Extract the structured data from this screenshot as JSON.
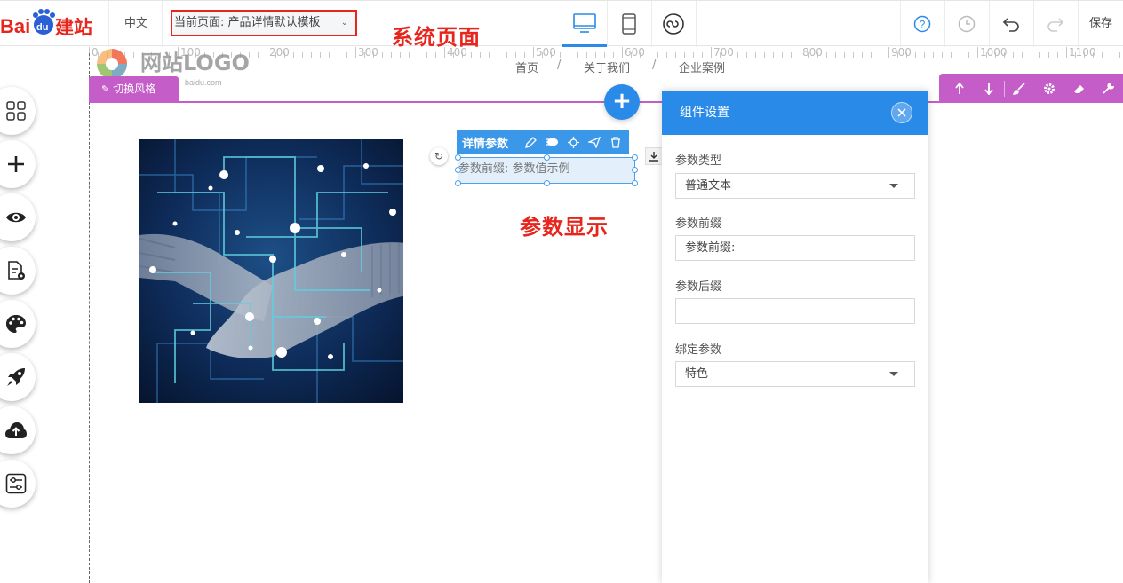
{
  "topbar": {
    "logo_text": "Bai建站",
    "language": "中文",
    "current_page": "当前页面: 产品详情默认模板",
    "annotation": "系统页面",
    "save_label": "保存"
  },
  "canvas": {
    "site_logo_text": "网站LOGO",
    "site_logo_sub": "baidu.com",
    "nav": [
      "首页",
      "关于我们",
      "企业案例"
    ],
    "nav_separator": "/",
    "style_button_label": "切换风格",
    "ruler_labels": [
      "0",
      "100",
      "200",
      "300",
      "400",
      "500",
      "600",
      "700",
      "800",
      "900",
      "1000",
      "1100"
    ],
    "annotation": "参数显示"
  },
  "element": {
    "toolbar_title": "详情参数",
    "text": "参数前缀: 参数值示例"
  },
  "panel": {
    "title": "组件设置",
    "fields": [
      {
        "label": "参数类型",
        "value": "普通文本",
        "type": "select"
      },
      {
        "label": "参数前缀",
        "value": "参数前缀:",
        "type": "text"
      },
      {
        "label": "参数后缀",
        "value": "",
        "type": "text"
      },
      {
        "label": "绑定参数",
        "value": "特色",
        "type": "select"
      }
    ]
  },
  "colors": {
    "accent_blue": "#2a8ae8",
    "purple": "#c55dc9",
    "annotation_red": "#e8251c"
  }
}
